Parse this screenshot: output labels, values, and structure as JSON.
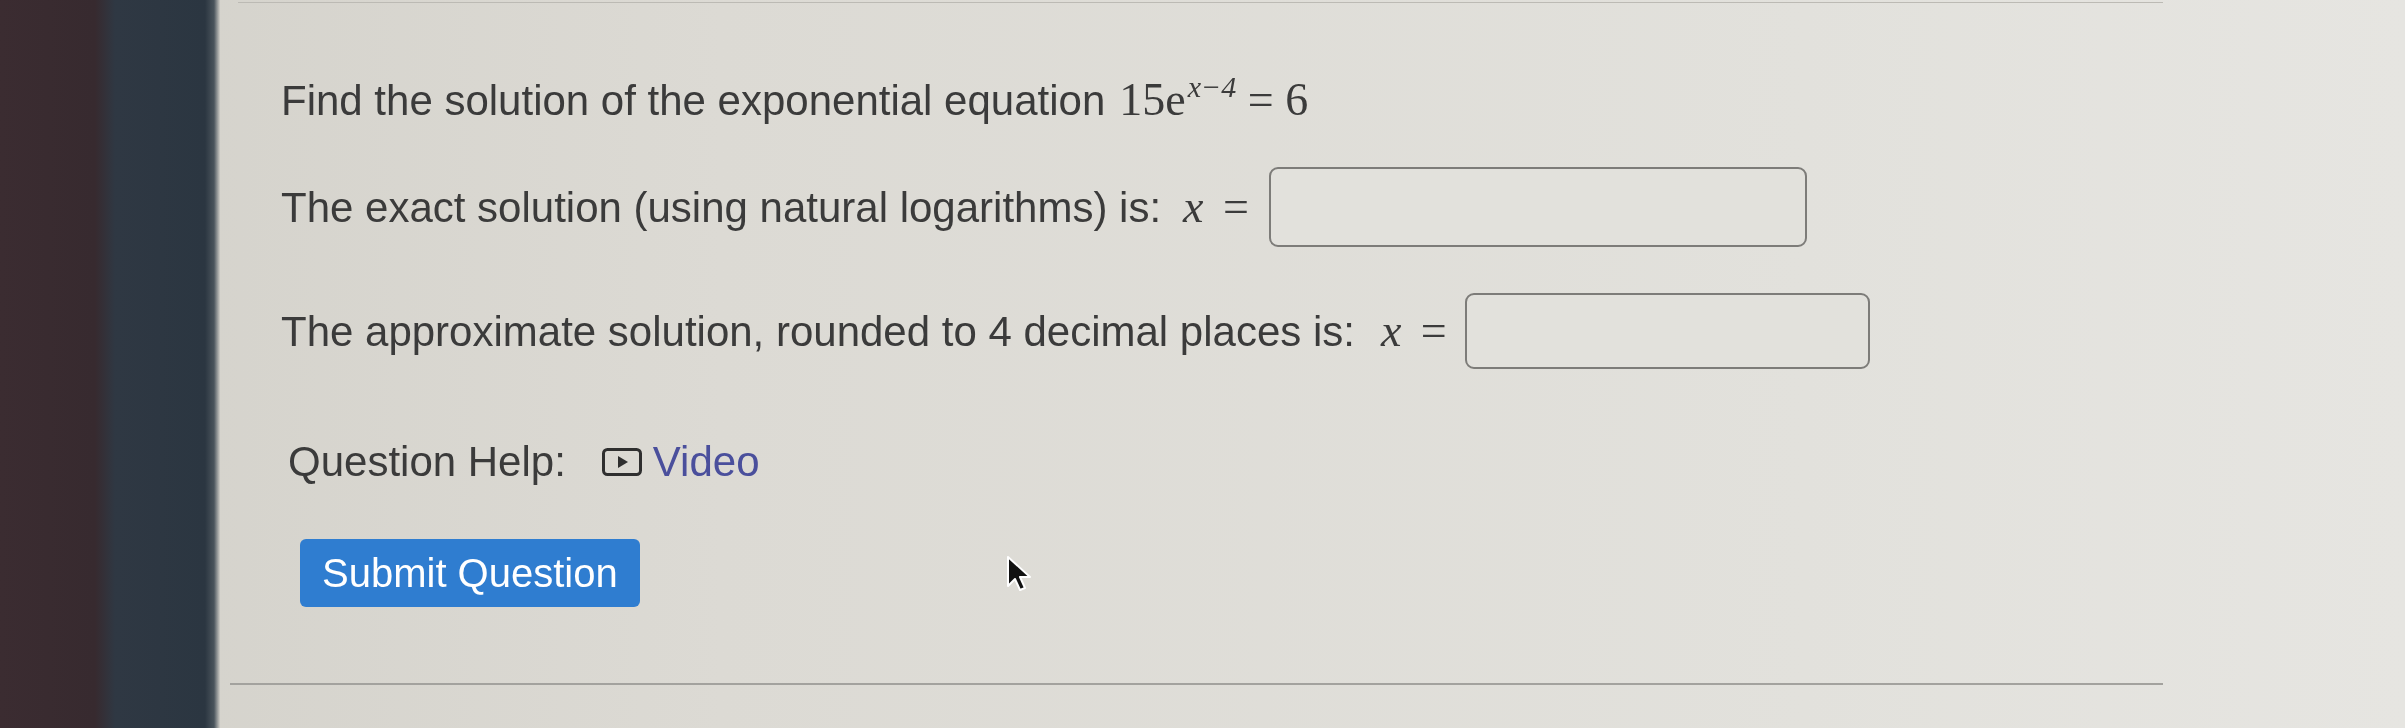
{
  "question": {
    "text": "Find the solution of the exponential equation",
    "math": "15e$^{x−4}$ = 6"
  },
  "answers": [
    {
      "label": "The exact solution (using natural logarithms) is:",
      "math": "*x* ="
    },
    {
      "label": "The approximate solution, rounded to 4 decimal places is:",
      "math": "*x* ="
    }
  ],
  "help": {
    "label": "Question Help:",
    "links": [
      {
        "kind": "video",
        "label": "Video"
      }
    ]
  },
  "submit": {
    "label": "Submit Question"
  }
}
